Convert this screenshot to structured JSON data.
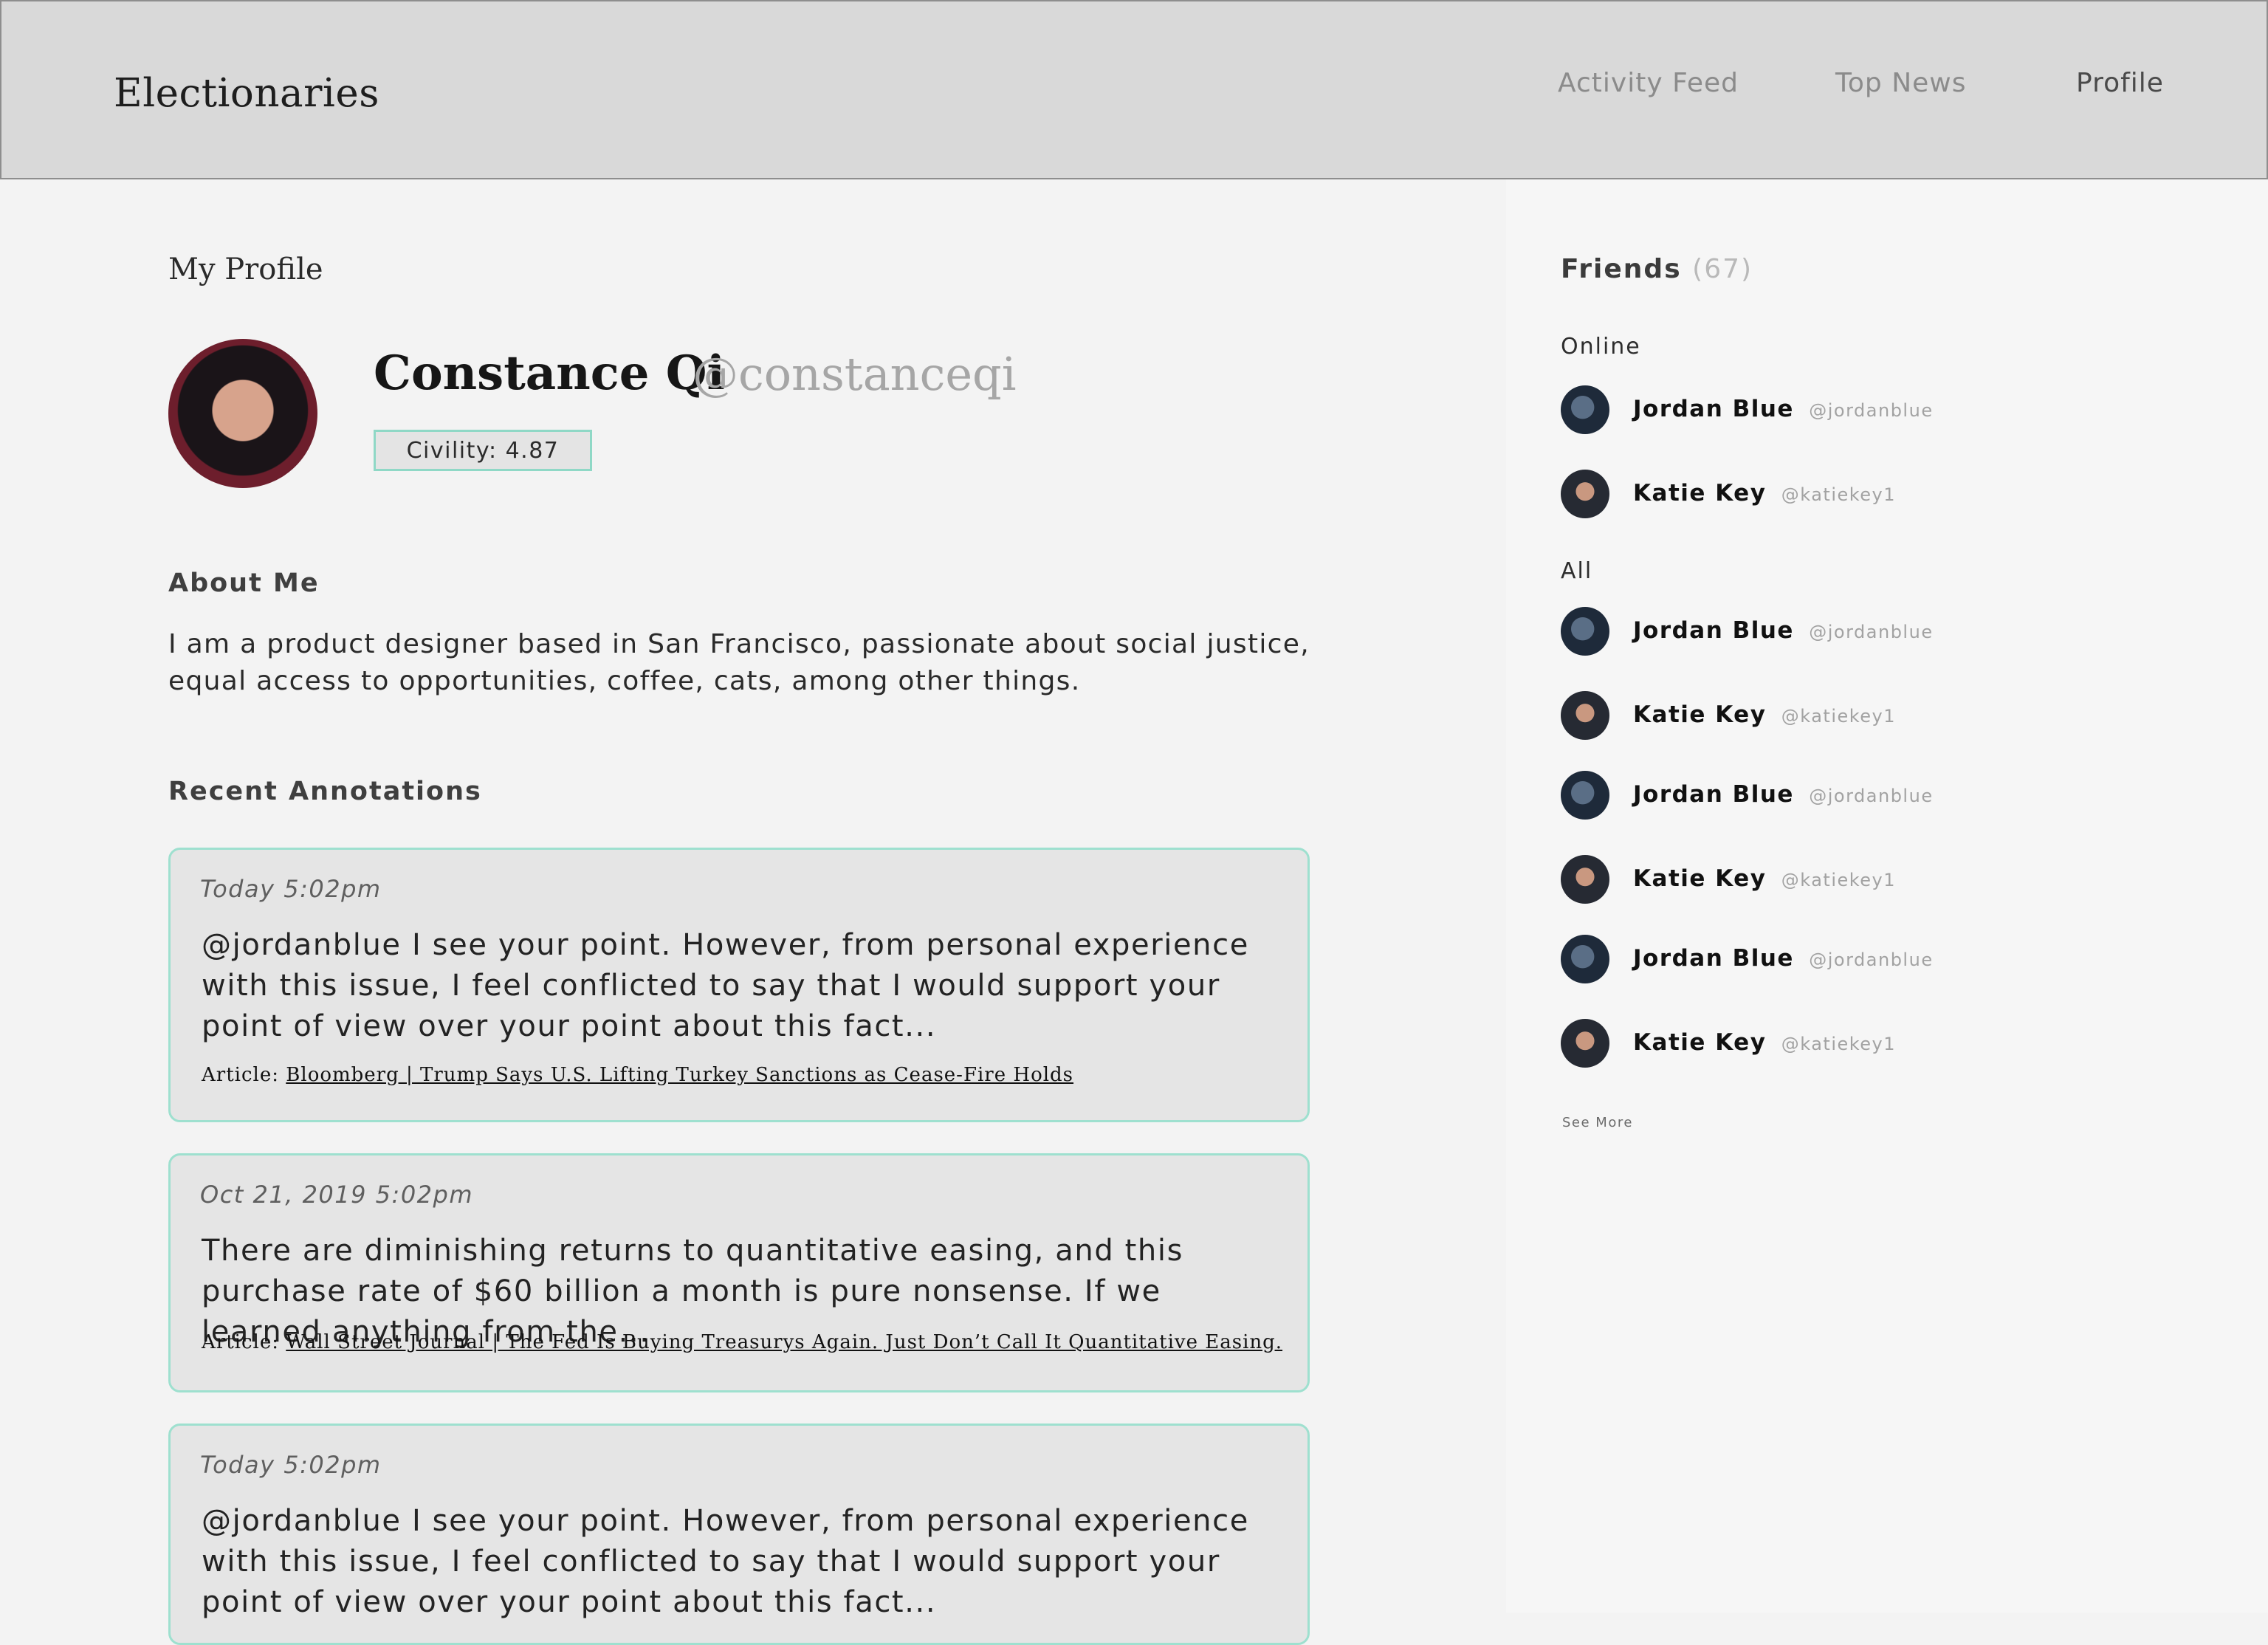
{
  "header": {
    "brand": "Electionaries",
    "nav": [
      "Activity Feed",
      "Top News",
      "Profile"
    ]
  },
  "profile": {
    "section_title": "My Profile",
    "name": "Constance Qi",
    "handle": "@constanceqi",
    "civility": "Civility: 4.87",
    "about_title": "About Me",
    "about_text": "I am a product designer based in San Francisco, passionate about social justice, equal access to opportunities, coffee, cats, among other things.",
    "annotations_title": "Recent Annotations"
  },
  "annotations": [
    {
      "date": "Today 5:02pm",
      "text": "@jordanblue I see your point. However, from personal experience with this issue, I feel conflicted to say that I would support your point of view over your point about this fact...",
      "article_label": "Article:",
      "article_link": "Bloomberg | Trump Says U.S. Lifting Turkey Sanctions as Cease-Fire Holds"
    },
    {
      "date": "Oct 21, 2019 5:02pm",
      "text": "There are diminishing returns to quantitative easing, and this purchase rate of $60 billion a month is pure nonsense. If we learned anything from the...",
      "article_label": "Article:",
      "article_link": "Wall Street Journal | The Fed Is Buying Treasurys Again. Just Don’t Call It Quantitative Easing."
    },
    {
      "date": "Today 5:02pm",
      "text": "@jordanblue I see your point. However, from personal experience with this issue, I feel conflicted to say that I would support your point of view over your point about this fact..."
    }
  ],
  "friends": {
    "title": "Friends",
    "count": "(67)",
    "online_label": "Online",
    "all_label": "All",
    "online": [
      {
        "name": "Jordan Blue",
        "handle": "@jordanblue"
      },
      {
        "name": "Katie Key",
        "handle": "@katiekey1"
      }
    ],
    "all": [
      {
        "name": "Jordan Blue",
        "handle": "@jordanblue"
      },
      {
        "name": "Katie Key",
        "handle": "@katiekey1"
      },
      {
        "name": "Jordan Blue",
        "handle": "@jordanblue"
      },
      {
        "name": "Katie Key",
        "handle": "@katiekey1"
      },
      {
        "name": "Jordan Blue",
        "handle": "@jordanblue"
      },
      {
        "name": "Katie Key",
        "handle": "@katiekey1"
      }
    ],
    "see_more": "See More"
  }
}
